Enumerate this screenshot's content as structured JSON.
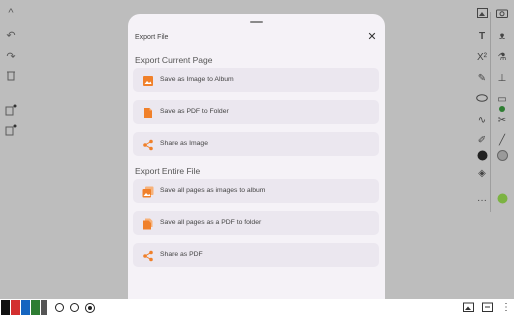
{
  "sheet": {
    "title": "Export File",
    "sections": [
      {
        "title": "Export Current Page",
        "items": [
          {
            "label": "Save as Image to Album",
            "icon": "image-icon"
          },
          {
            "label": "Save as PDF to Folder",
            "icon": "pdf-file-icon"
          },
          {
            "label": "Share as Image",
            "icon": "share-icon"
          }
        ]
      },
      {
        "title": "Export Entire File",
        "items": [
          {
            "label": "Save all pages as images to album",
            "icon": "images-icon"
          },
          {
            "label": "Save all pages as a PDF to folder",
            "icon": "pdf-files-icon"
          },
          {
            "label": "Share as PDF",
            "icon": "share-icon"
          }
        ]
      }
    ]
  },
  "colors": {
    "accent": "#f0802a",
    "overlay": "#bdbdbd",
    "sheet": "#f5f2f7",
    "item": "#ebe7ef",
    "green_dot": "#2e7d32"
  },
  "bottom_bar": {
    "swatches": [
      "#111111",
      "#d32f2f",
      "#1565c0",
      "#2e7d32"
    ]
  }
}
